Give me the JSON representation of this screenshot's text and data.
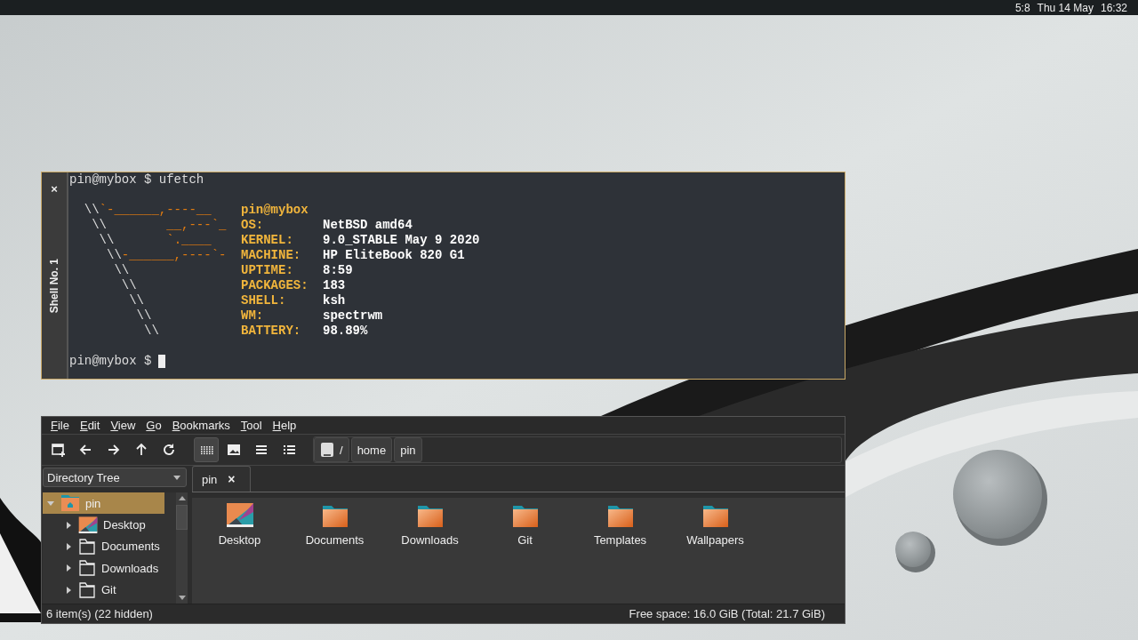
{
  "top_bar": {
    "items": [
      "5:8",
      "Thu 14 May",
      "16:32"
    ]
  },
  "terminal": {
    "tab": {
      "label": "Shell No. 1",
      "close": "×"
    },
    "command_line": "pin@mybox $ ufetch",
    "logo": [
      [
        {
          "text": "  \\\\",
          "kind": "plain"
        },
        {
          "text": "`-______,----__",
          "kind": "accent"
        }
      ],
      [
        {
          "text": "   \\\\",
          "kind": "plain"
        },
        {
          "text": "        __,---`_",
          "kind": "accent"
        }
      ],
      [
        {
          "text": "    \\\\",
          "kind": "plain"
        },
        {
          "text": "       `.____",
          "kind": "accent"
        }
      ],
      [
        {
          "text": "     \\\\",
          "kind": "plain"
        },
        {
          "text": "-______,----`-",
          "kind": "accent"
        }
      ],
      [
        {
          "text": "      \\\\",
          "kind": "plain"
        }
      ],
      [
        {
          "text": "       \\\\",
          "kind": "plain"
        }
      ],
      [
        {
          "text": "        \\\\",
          "kind": "plain"
        }
      ],
      [
        {
          "text": "         \\\\",
          "kind": "plain"
        }
      ],
      [
        {
          "text": "          \\\\",
          "kind": "plain"
        }
      ]
    ],
    "info_header": "pin@mybox",
    "info": [
      {
        "label": "OS:",
        "value": "NetBSD amd64"
      },
      {
        "label": "KERNEL:",
        "value": "9.0_STABLE May 9 2020"
      },
      {
        "label": "MACHINE:",
        "value": "HP EliteBook 820 G1"
      },
      {
        "label": "UPTIME:",
        "value": "8:59"
      },
      {
        "label": "PACKAGES:",
        "value": "183"
      },
      {
        "label": "SHELL:",
        "value": "ksh"
      },
      {
        "label": "WM:",
        "value": "spectrwm"
      },
      {
        "label": "BATTERY:",
        "value": "98.89%"
      }
    ],
    "prompt": "pin@mybox $"
  },
  "file_manager": {
    "menu": [
      "File",
      "Edit",
      "View",
      "Go",
      "Bookmarks",
      "Tool",
      "Help"
    ],
    "view_modes": [
      {
        "kind": "icons",
        "selected": true
      },
      {
        "kind": "thumbnails",
        "selected": false
      },
      {
        "kind": "compact",
        "selected": false
      },
      {
        "kind": "details",
        "selected": false
      }
    ],
    "path": [
      "/",
      "home",
      "pin"
    ],
    "side_pane": {
      "mode": "Directory Tree",
      "tree": [
        {
          "label": "pin",
          "kind": "home",
          "selected": true,
          "expanded": true,
          "children": [
            {
              "label": "Desktop",
              "kind": "desktop",
              "selected": false,
              "expanded": false
            },
            {
              "label": "Documents",
              "kind": "folder",
              "selected": false,
              "expanded": false
            },
            {
              "label": "Downloads",
              "kind": "folder",
              "selected": false,
              "expanded": false
            },
            {
              "label": "Git",
              "kind": "folder",
              "selected": false,
              "expanded": false
            }
          ]
        }
      ]
    },
    "tabs": [
      {
        "label": "pin",
        "close": "×",
        "selected": true
      }
    ],
    "items": [
      {
        "name": "Desktop",
        "kind": "desktop"
      },
      {
        "name": "Documents",
        "kind": "folder"
      },
      {
        "name": "Downloads",
        "kind": "folder"
      },
      {
        "name": "Git",
        "kind": "folder"
      },
      {
        "name": "Templates",
        "kind": "folder"
      },
      {
        "name": "Wallpapers",
        "kind": "folder"
      }
    ],
    "status": {
      "left": "6 item(s) (22 hidden)",
      "right": "Free space: 16.0 GiB (Total: 21.7 GiB)"
    }
  }
}
